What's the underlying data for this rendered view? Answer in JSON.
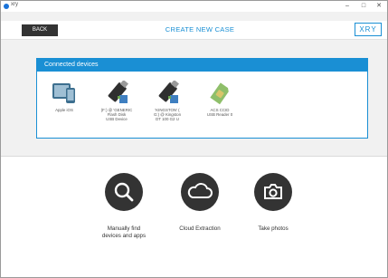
{
  "window": {
    "app_name": "xry",
    "minimize": "–",
    "maximize": "□",
    "close": "✕"
  },
  "header": {
    "back_label": "BACK",
    "title": "CREATE NEW CASE",
    "logo": "XRY"
  },
  "connected": {
    "title": "Connected devices",
    "devices": [
      {
        "label": "Apple iOS",
        "icon": "tablet-phone-icon"
      },
      {
        "label": "(F:) @ 'GENERIC\nFlash Disk\nUSB Device",
        "icon": "flash-drive-icon"
      },
      {
        "label": "'KINGSTON' (\nG:) @ Kingston\nDT 100 G2 U",
        "icon": "flash-drive-icon"
      },
      {
        "label": "ACS CCID\nUSB Reader 0",
        "icon": "sim-card-icon"
      }
    ]
  },
  "actions": [
    {
      "label": "Manually find\ndevices and apps",
      "icon": "search-icon"
    },
    {
      "label": "Cloud Extraction",
      "icon": "cloud-icon"
    },
    {
      "label": "Take photos",
      "icon": "camera-icon"
    }
  ]
}
